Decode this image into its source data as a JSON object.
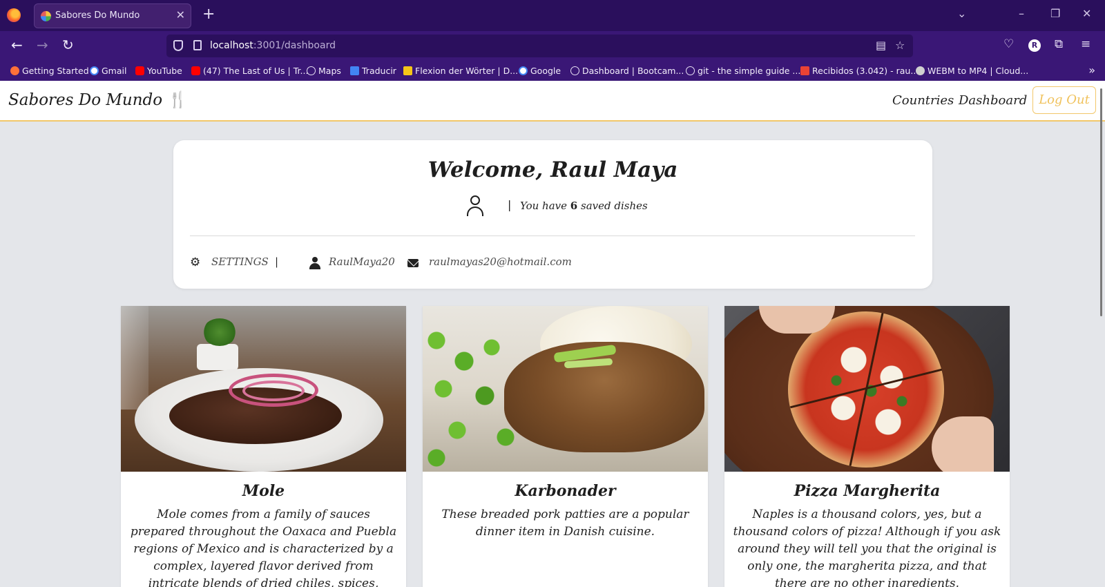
{
  "browser": {
    "tab_title": "Sabores Do Mundo",
    "new_tab": "+",
    "url_host": "localhost",
    "url_path": ":3001/dashboard",
    "bookmarks": [
      {
        "label": "Getting Started",
        "icon_color": "#ff7139"
      },
      {
        "label": "Gmail",
        "icon_color": "#4285f4"
      },
      {
        "label": "YouTube",
        "icon_color": "#ff0000"
      },
      {
        "label": "(47) The Last of Us | Tr...",
        "icon_color": "#ff0000"
      },
      {
        "label": "Maps",
        "icon_color": "#e8e0f5"
      },
      {
        "label": "Traducir",
        "icon_color": "#4285f4"
      },
      {
        "label": "Flexion der Wörter | D...",
        "icon_color": "#f5c518"
      },
      {
        "label": "Google",
        "icon_color": "#4285f4"
      },
      {
        "label": "Dashboard | Bootcam...",
        "icon_color": "#e8e0f5"
      },
      {
        "label": "git - the simple guide ...",
        "icon_color": "#e8e0f5"
      },
      {
        "label": "Recibidos (3.042) - rau...",
        "icon_color": "#ea4335"
      },
      {
        "label": "WEBM to MP4 | Cloud...",
        "icon_color": "#d0d0d0"
      }
    ]
  },
  "app": {
    "brand": "Sabores Do Mundo",
    "brand_icon": "🍴",
    "nav": {
      "countries": "Countries",
      "dashboard": "Dashboard",
      "logout": "Log Out"
    },
    "accent_color": "#f2c76a"
  },
  "welcome": {
    "title": "Welcome, Raul Maya",
    "separator": "|",
    "saved_prefix": "You have",
    "saved_count": "6",
    "saved_suffix": "saved dishes",
    "settings_label": "SETTINGS",
    "username": "RaulMaya20",
    "email": "raulmayas20@hotmail.com"
  },
  "dishes": [
    {
      "name": "Mole",
      "description": "Mole comes from a family of sauces prepared throughout the Oaxaca and Puebla regions of Mexico and is characterized by a complex, layered flavor derived from intricate blends of dried chiles, spices, fruits, and"
    },
    {
      "name": "Karbonader",
      "description": "These breaded pork patties are a popular dinner item in Danish cuisine."
    },
    {
      "name": "Pizza Margherita",
      "description": "Naples is a thousand colors, yes, but a thousand colors of pizza! Although if you ask around they will tell you that the original is only one, the margherita pizza, and that there are no other ingredients."
    }
  ]
}
